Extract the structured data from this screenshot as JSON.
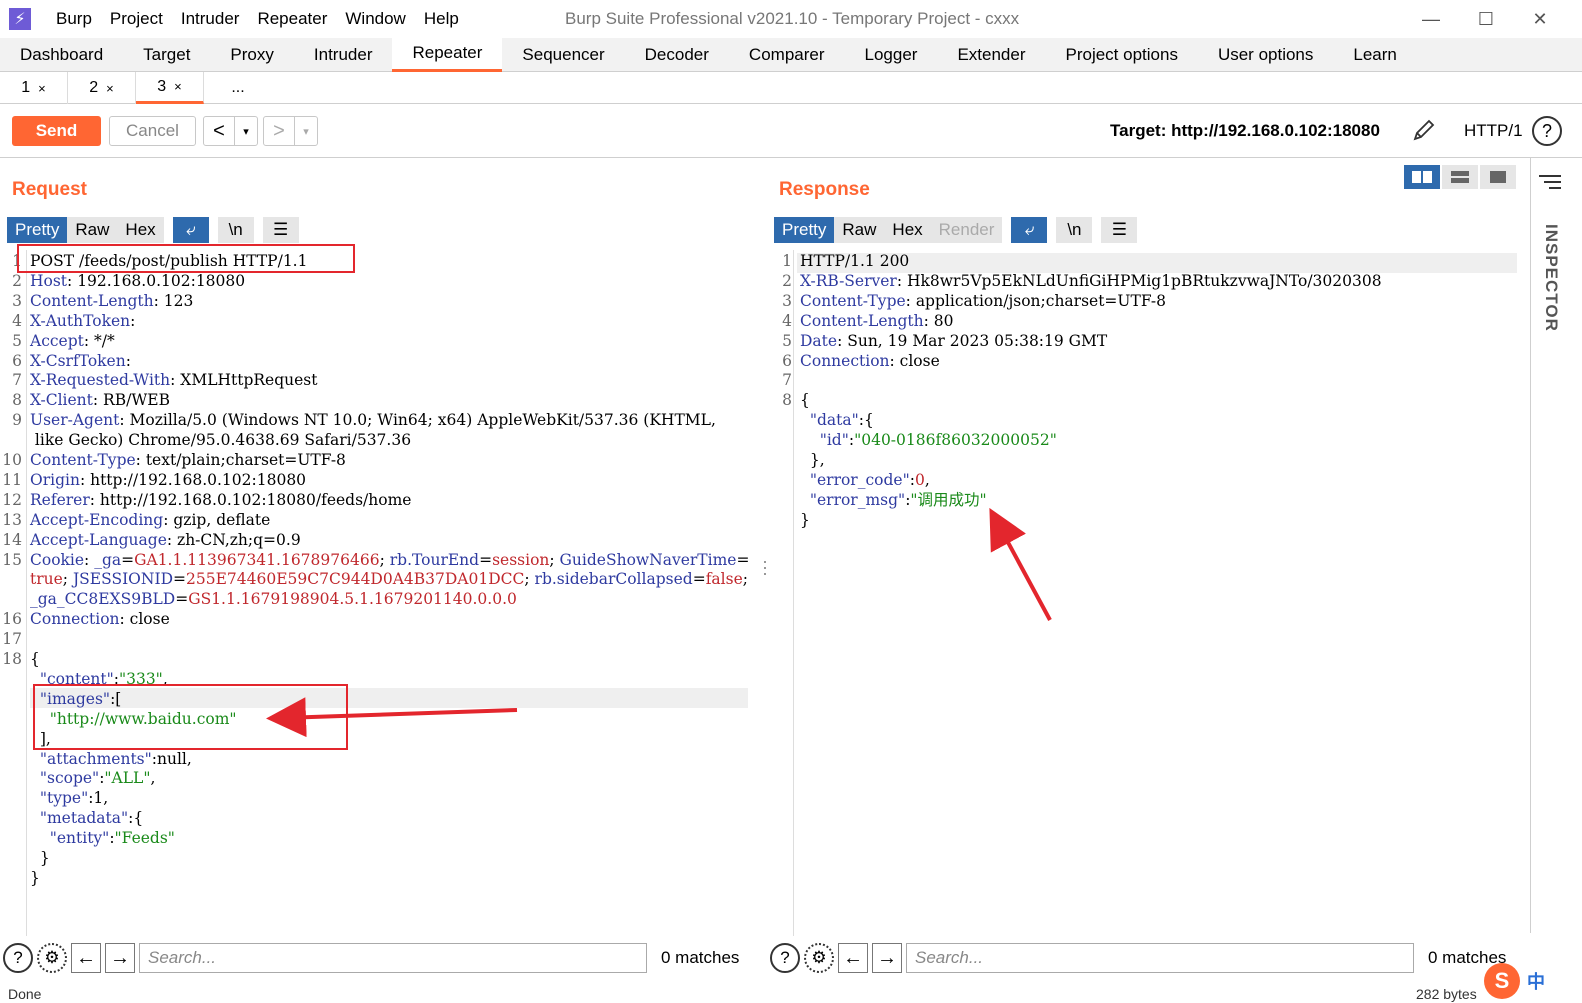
{
  "titlebar": {
    "menu": [
      "Burp",
      "Project",
      "Intruder",
      "Repeater",
      "Window",
      "Help"
    ],
    "title": "Burp Suite Professional v2021.10 - Temporary Project - cxxx"
  },
  "main_tabs": [
    "Dashboard",
    "Target",
    "Proxy",
    "Intruder",
    "Repeater",
    "Sequencer",
    "Decoder",
    "Comparer",
    "Logger",
    "Extender",
    "Project options",
    "User options",
    "Learn"
  ],
  "active_main_tab": "Repeater",
  "sub_tabs": [
    {
      "label": "1",
      "close": "×"
    },
    {
      "label": "2",
      "close": "×"
    },
    {
      "label": "3",
      "close": "×"
    }
  ],
  "sub_tab_more": "...",
  "toolbar": {
    "send": "Send",
    "cancel": "Cancel",
    "back": "<",
    "forward": ">",
    "dropdown": "▾",
    "target": "Target: http://192.168.0.102:18080",
    "http_version": "HTTP/1",
    "help": "?"
  },
  "request": {
    "title": "Request",
    "view_tabs": [
      "Pretty",
      "Raw",
      "Hex"
    ],
    "active_view": "Pretty",
    "newline_btn": "\\n",
    "lines": [
      {
        "n": "1",
        "parts": [
          [
            "",
            "POST /feeds/post/publish HTTP/1.1"
          ]
        ]
      },
      {
        "n": "2",
        "parts": [
          [
            "k",
            "Host"
          ],
          [
            "",
            ": 192.168.0.102:18080"
          ]
        ]
      },
      {
        "n": "3",
        "parts": [
          [
            "k",
            "Content-Length"
          ],
          [
            "",
            ": 123"
          ]
        ]
      },
      {
        "n": "4",
        "parts": [
          [
            "k",
            "X-AuthToken"
          ],
          [
            "",
            ":"
          ]
        ]
      },
      {
        "n": "5",
        "parts": [
          [
            "k",
            "Accept"
          ],
          [
            "",
            ": */*"
          ]
        ]
      },
      {
        "n": "6",
        "parts": [
          [
            "k",
            "X-CsrfToken"
          ],
          [
            "",
            ":"
          ]
        ]
      },
      {
        "n": "7",
        "parts": [
          [
            "k",
            "X-Requested-With"
          ],
          [
            "",
            ": XMLHttpRequest"
          ]
        ]
      },
      {
        "n": "8",
        "parts": [
          [
            "k",
            "X-Client"
          ],
          [
            "",
            ": RB/WEB"
          ]
        ]
      },
      {
        "n": "9",
        "parts": [
          [
            "k",
            "User-Agent"
          ],
          [
            "",
            ": Mozilla/5.0 (Windows NT 10.0; Win64; x64) AppleWebKit/537.36 (KHTML,"
          ]
        ]
      },
      {
        "n": "",
        "parts": [
          [
            "",
            " like Gecko) Chrome/95.0.4638.69 Safari/537.36"
          ]
        ]
      },
      {
        "n": "10",
        "parts": [
          [
            "k",
            "Content-Type"
          ],
          [
            "",
            ": text/plain;charset=UTF-8"
          ]
        ]
      },
      {
        "n": "11",
        "parts": [
          [
            "k",
            "Origin"
          ],
          [
            "",
            ": http://192.168.0.102:18080"
          ]
        ]
      },
      {
        "n": "12",
        "parts": [
          [
            "k",
            "Referer"
          ],
          [
            "",
            ": http://192.168.0.102:18080/feeds/home"
          ]
        ]
      },
      {
        "n": "13",
        "parts": [
          [
            "k",
            "Accept-Encoding"
          ],
          [
            "",
            ": gzip, deflate"
          ]
        ]
      },
      {
        "n": "14",
        "parts": [
          [
            "k",
            "Accept-Language"
          ],
          [
            "",
            ": zh-CN,zh;q=0.9"
          ]
        ]
      },
      {
        "n": "15",
        "parts": [
          [
            "k",
            "Cookie"
          ],
          [
            "",
            ": "
          ],
          [
            "k",
            "_ga"
          ],
          [
            "",
            "="
          ],
          [
            "r",
            "GA1.1.113967341.1678976466"
          ],
          [
            "",
            "; "
          ],
          [
            "k",
            "rb.TourEnd"
          ],
          [
            "",
            "="
          ],
          [
            "r",
            "session"
          ],
          [
            "",
            "; "
          ],
          [
            "k",
            "GuideShowNaverTime"
          ],
          [
            "",
            "="
          ]
        ]
      },
      {
        "n": "",
        "parts": [
          [
            "r",
            "true"
          ],
          [
            "",
            "; "
          ],
          [
            "k",
            "JSESSIONID"
          ],
          [
            "",
            "="
          ],
          [
            "r",
            "255E74460E59C7C944D0A4B37DA01DCC"
          ],
          [
            "",
            "; "
          ],
          [
            "k",
            "rb.sidebarCollapsed"
          ],
          [
            "",
            "="
          ],
          [
            "r",
            "false"
          ],
          [
            "",
            ";"
          ]
        ]
      },
      {
        "n": "",
        "parts": [
          [
            "k",
            "_ga_CC8EXS9BLD"
          ],
          [
            "",
            "="
          ],
          [
            "r",
            "GS1.1.1679198904.5.1.1679201140.0.0.0"
          ]
        ]
      },
      {
        "n": "16",
        "parts": [
          [
            "k",
            "Connection"
          ],
          [
            "",
            ": close"
          ]
        ]
      },
      {
        "n": "17",
        "parts": [
          [
            "",
            ""
          ]
        ]
      },
      {
        "n": "18",
        "parts": [
          [
            "",
            "{"
          ]
        ]
      },
      {
        "n": "",
        "parts": [
          [
            "",
            "  "
          ],
          [
            "k",
            "\"content\""
          ],
          [
            "",
            ":"
          ],
          [
            "s",
            "\"333\""
          ],
          [
            "",
            ","
          ]
        ]
      },
      {
        "n": "",
        "parts": [
          [
            "",
            "  "
          ],
          [
            "k",
            "\"images\""
          ],
          [
            "",
            ":["
          ]
        ]
      },
      {
        "n": "",
        "parts": [
          [
            "",
            "    "
          ],
          [
            "s",
            "\"http://www.baidu.com\""
          ]
        ]
      },
      {
        "n": "",
        "parts": [
          [
            "",
            "  ],"
          ]
        ]
      },
      {
        "n": "",
        "parts": [
          [
            "",
            "  "
          ],
          [
            "k",
            "\"attachments\""
          ],
          [
            "",
            ":null,"
          ]
        ]
      },
      {
        "n": "",
        "parts": [
          [
            "",
            "  "
          ],
          [
            "k",
            "\"scope\""
          ],
          [
            "",
            ":"
          ],
          [
            "s",
            "\"ALL\""
          ],
          [
            "",
            ","
          ]
        ]
      },
      {
        "n": "",
        "parts": [
          [
            "",
            "  "
          ],
          [
            "k",
            "\"type\""
          ],
          [
            "",
            ":1,"
          ]
        ]
      },
      {
        "n": "",
        "parts": [
          [
            "",
            "  "
          ],
          [
            "k",
            "\"metadata\""
          ],
          [
            "",
            ":{"
          ]
        ]
      },
      {
        "n": "",
        "parts": [
          [
            "",
            "    "
          ],
          [
            "k",
            "\"entity\""
          ],
          [
            "",
            ":"
          ],
          [
            "s",
            "\"Feeds\""
          ]
        ]
      },
      {
        "n": "",
        "parts": [
          [
            "",
            "  }"
          ]
        ]
      },
      {
        "n": "",
        "parts": [
          [
            "",
            "}"
          ]
        ]
      }
    ],
    "search_placeholder": "Search...",
    "matches": "0 matches"
  },
  "response": {
    "title": "Response",
    "view_tabs": [
      "Pretty",
      "Raw",
      "Hex",
      "Render"
    ],
    "active_view": "Pretty",
    "newline_btn": "\\n",
    "lines": [
      {
        "n": "1",
        "parts": [
          [
            "",
            "HTTP/1.1 200"
          ]
        ]
      },
      {
        "n": "2",
        "parts": [
          [
            "k",
            "X-RB-Server"
          ],
          [
            "",
            ": Hk8wr5Vp5EkNLdUnfiGiHPMig1pBRtukzvwaJNTo/3020308"
          ]
        ]
      },
      {
        "n": "3",
        "parts": [
          [
            "k",
            "Content-Type"
          ],
          [
            "",
            ": application/json;charset=UTF-8"
          ]
        ]
      },
      {
        "n": "4",
        "parts": [
          [
            "k",
            "Content-Length"
          ],
          [
            "",
            ": 80"
          ]
        ]
      },
      {
        "n": "5",
        "parts": [
          [
            "k",
            "Date"
          ],
          [
            "",
            ": Sun, 19 Mar 2023 05:38:19 GMT"
          ]
        ]
      },
      {
        "n": "6",
        "parts": [
          [
            "k",
            "Connection"
          ],
          [
            "",
            ": close"
          ]
        ]
      },
      {
        "n": "7",
        "parts": [
          [
            "",
            ""
          ]
        ]
      },
      {
        "n": "8",
        "parts": [
          [
            "",
            "{"
          ]
        ]
      },
      {
        "n": "",
        "parts": [
          [
            "",
            "  "
          ],
          [
            "k",
            "\"data\""
          ],
          [
            "",
            ":{"
          ]
        ]
      },
      {
        "n": "",
        "parts": [
          [
            "",
            "    "
          ],
          [
            "k",
            "\"id\""
          ],
          [
            "",
            ":"
          ],
          [
            "s",
            "\"040-0186f86032000052\""
          ]
        ]
      },
      {
        "n": "",
        "parts": [
          [
            "",
            "  },"
          ]
        ]
      },
      {
        "n": "",
        "parts": [
          [
            "",
            "  "
          ],
          [
            "k",
            "\"error_code\""
          ],
          [
            "",
            ":"
          ],
          [
            "r",
            "0"
          ],
          [
            "",
            ","
          ]
        ]
      },
      {
        "n": "",
        "parts": [
          [
            "",
            "  "
          ],
          [
            "k",
            "\"error_msg\""
          ],
          [
            "",
            ":"
          ],
          [
            "s",
            "\"调用成功\""
          ]
        ]
      },
      {
        "n": "",
        "parts": [
          [
            "",
            "}"
          ]
        ]
      }
    ],
    "search_placeholder": "Search...",
    "matches": "0 matches"
  },
  "inspector_label": "INSPECTOR",
  "status": {
    "left": "Done",
    "right": "282 bytes"
  },
  "ime": {
    "logo": "S",
    "lang": "中"
  },
  "colors": {
    "accent": "#ff6633",
    "active_blue": "#2e6aad",
    "header_key": "#2e3aa0",
    "string": "#1a8a1a",
    "value_red": "#c0282d",
    "annotation_red": "#e3262d"
  }
}
